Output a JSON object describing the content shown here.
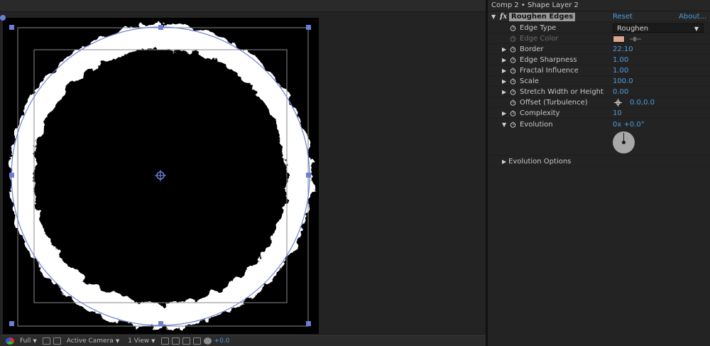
{
  "colors": {
    "accent_value": "#4f9cdb",
    "panel_bg": "#232323",
    "comp_bg": "#000000",
    "handle": "#6b7fd6",
    "edge_color": "#d9a590"
  },
  "viewer": {
    "toolbar": {
      "resolution": "Full",
      "camera": "Active Camera",
      "views": "1 View",
      "exposure": "+0.0"
    }
  },
  "effects_panel": {
    "title": "Comp 2 • Shape Layer 2",
    "effect": {
      "fx_label": "fx",
      "name": "Roughen Edges",
      "reset": "Reset",
      "about": "About..."
    },
    "properties": {
      "edge_type": {
        "label": "Edge Type",
        "value": "Roughen"
      },
      "edge_color": {
        "label": "Edge Color"
      },
      "border": {
        "label": "Border",
        "value": "22.10"
      },
      "edge_sharpness": {
        "label": "Edge Sharpness",
        "value": "1.00"
      },
      "fractal_influence": {
        "label": "Fractal Influence",
        "value": "1.00"
      },
      "scale": {
        "label": "Scale",
        "value": "100.0"
      },
      "stretch": {
        "label": "Stretch Width or Height",
        "value": "0.00"
      },
      "offset": {
        "label": "Offset (Turbulence)",
        "value": "0.0,0.0"
      },
      "complexity": {
        "label": "Complexity",
        "value": "10"
      },
      "evolution": {
        "label": "Evolution",
        "value": "0x +0.0°"
      },
      "evolution_options": {
        "label": "Evolution Options"
      }
    }
  }
}
